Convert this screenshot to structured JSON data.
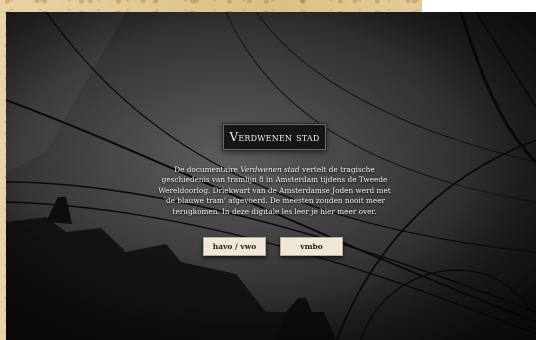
{
  "page": {
    "title": "Verdwenen stad",
    "intro": {
      "before": "De documentaire ",
      "film": "Verdwenen stad",
      "after": " vertelt de tragische geschiedenis van tramlijn 8 in Amsterdam tijdens de Tweede Wereldoorlog. Driekwart van de Amsterdamse Joden werd met 'de blauwe tram' afgevoerd. De meesten zouden nooit meer terugkomen. In deze digitale les leer je hier meer over."
    }
  },
  "buttons": {
    "havo_vwo": "havo / vwo",
    "vmbo": "vmbo"
  },
  "colors": {
    "parchment": "#e7cf9c",
    "stage_dark": "#1c1c1c",
    "title_bg": "#161616",
    "button_bg": "#efe6d6"
  }
}
